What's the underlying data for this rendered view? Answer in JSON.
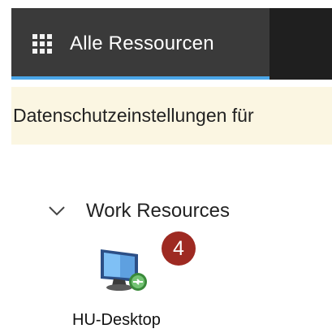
{
  "topbar": {
    "tab_label": "Alle Ressourcen",
    "waffle_icon": "app-launcher-icon"
  },
  "notice": {
    "text": "Datenschutzeinstellungen für"
  },
  "group": {
    "label": "Work Resources",
    "expanded": true
  },
  "resources": [
    {
      "label": "HU-Desktop",
      "icon": "remote-desktop-icon"
    }
  ],
  "annotation": {
    "badge_number": "4"
  },
  "colors": {
    "topbar_bg": "#3a3a3a",
    "accent": "#4aa6e8",
    "notice_bg": "#fbf6e2",
    "badge_bg": "#9e2a22"
  }
}
